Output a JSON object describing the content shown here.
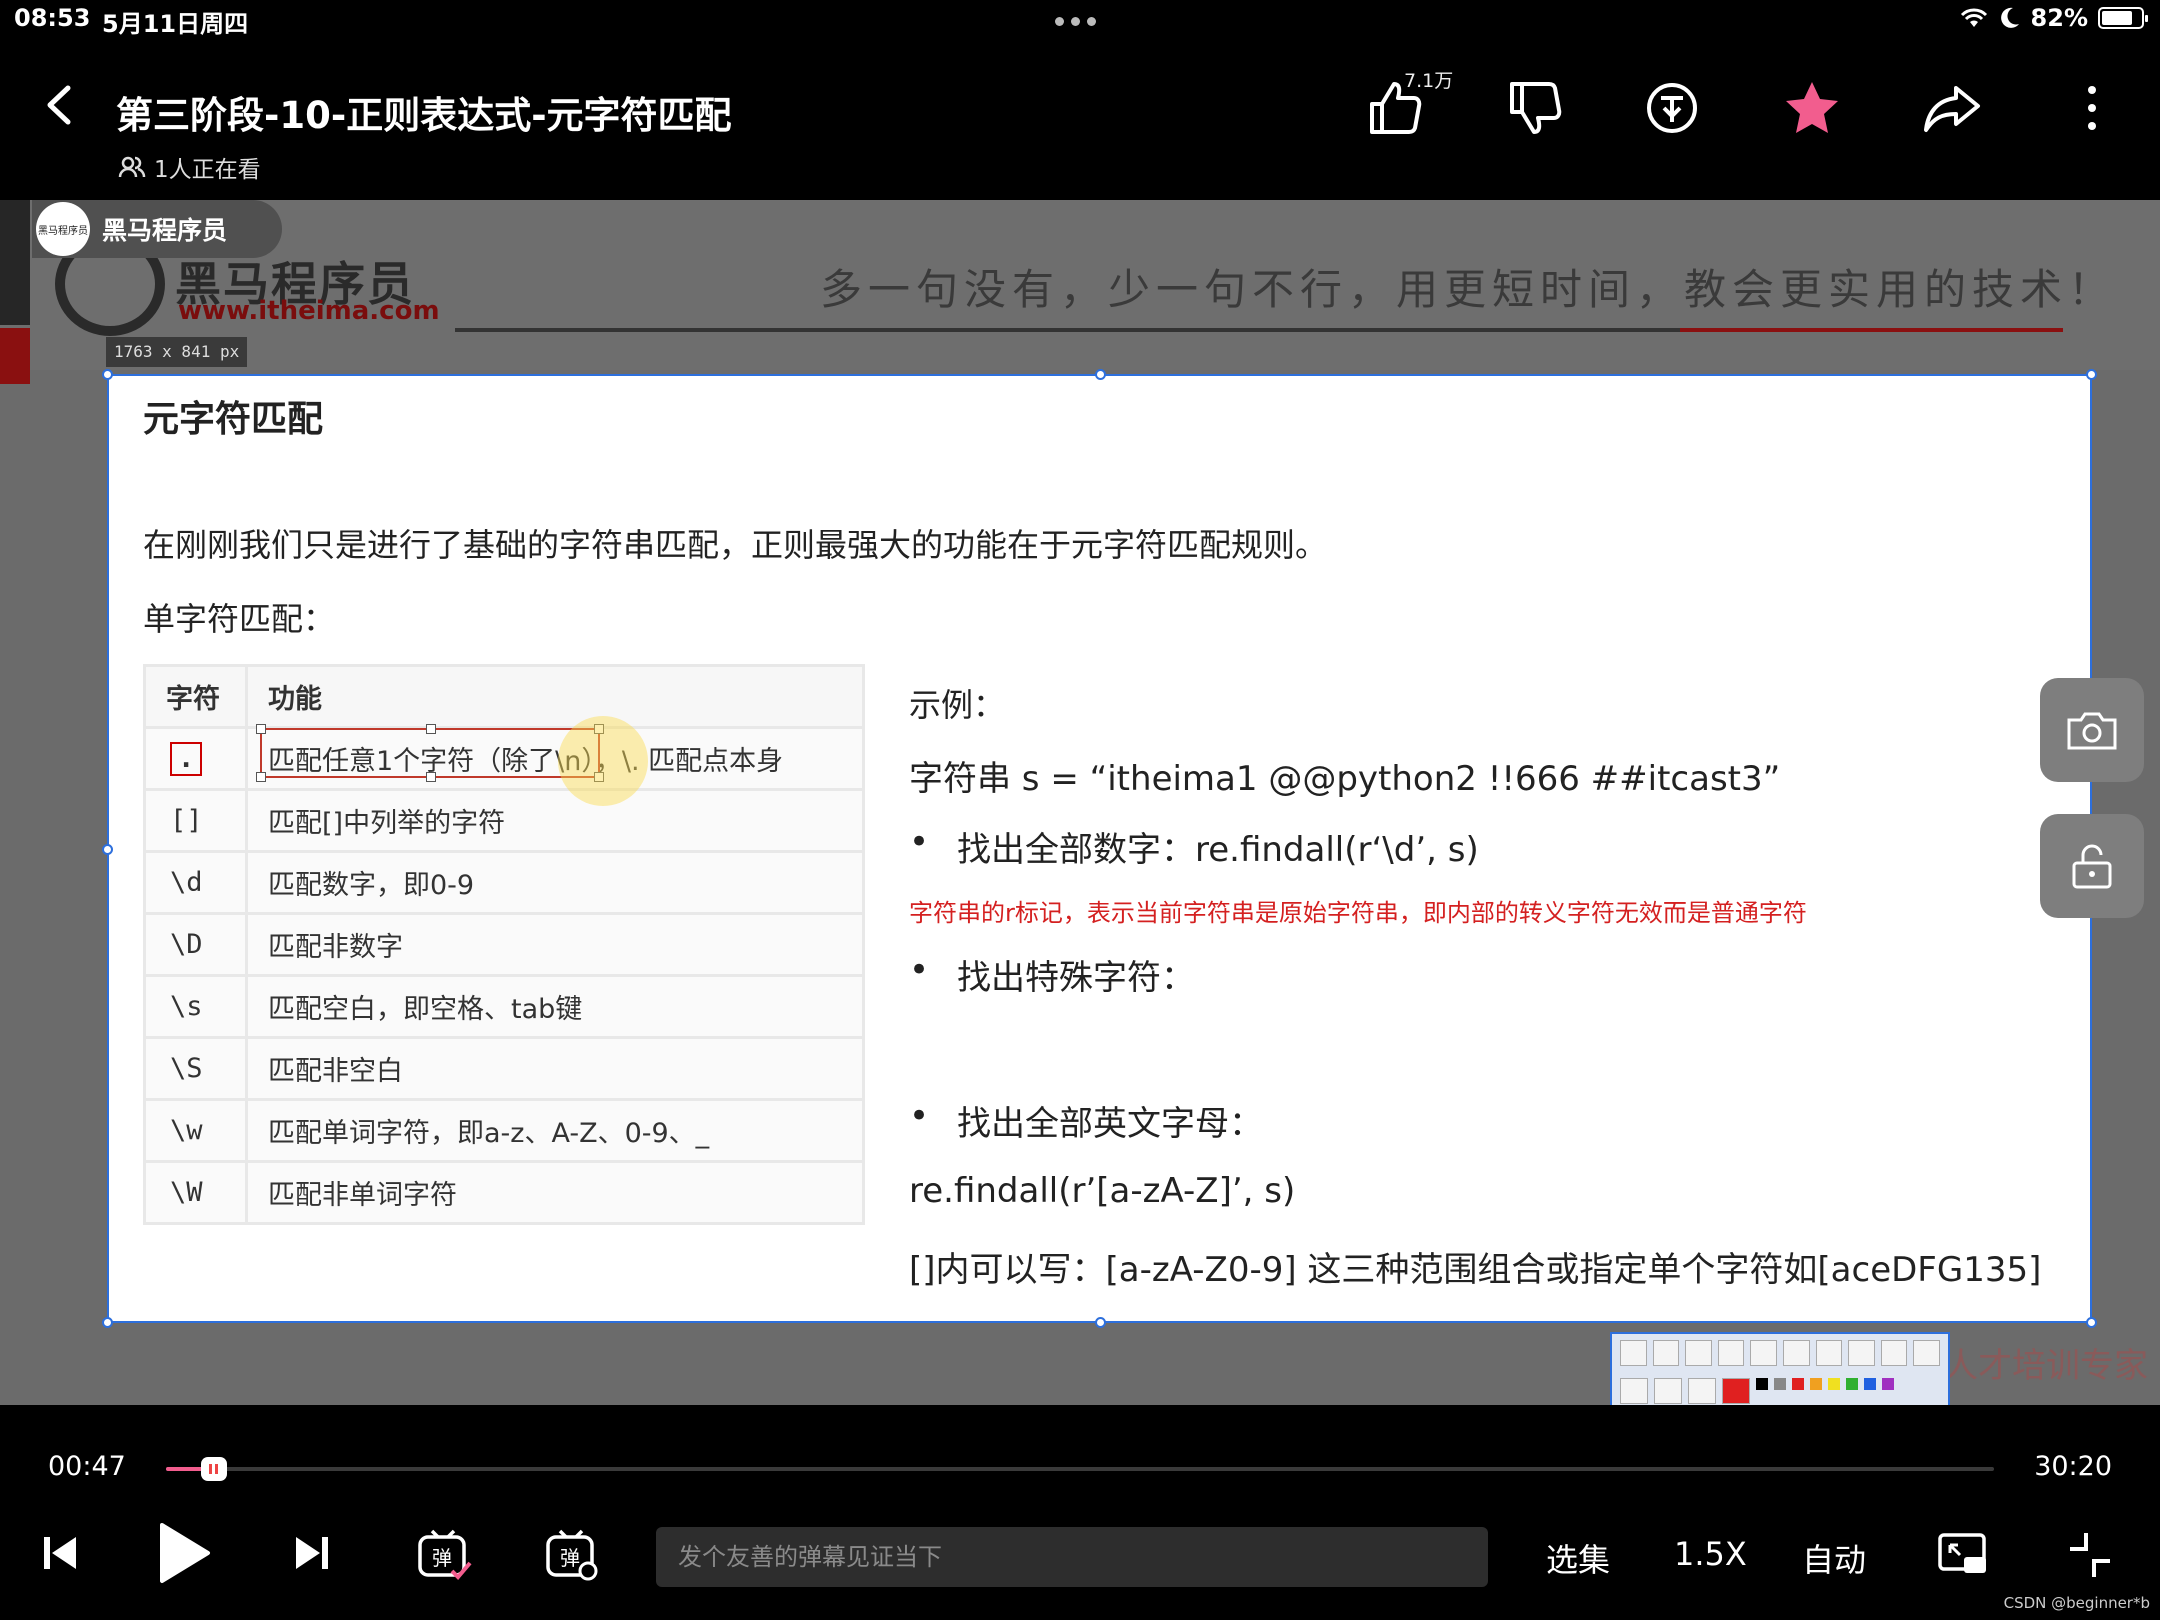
{
  "status_bar": {
    "time": "08:53",
    "date": "5月11日周四",
    "battery": "82%"
  },
  "header": {
    "title": "第三阶段-10-正则表达式-元字符匹配",
    "viewers": "1人正在看",
    "like_count": "7.1万"
  },
  "channel": {
    "name": "黑马程序员",
    "avatar_text": "黑马程序员"
  },
  "banner": {
    "brand_name": "黑马程序员",
    "brand_url": "www.itheima.com",
    "slogan": "多一句没有，少一句不行，用更短时间，教会更实用的技术！"
  },
  "dimension_label": "1763 x 841 px",
  "slide": {
    "title": "元字符匹配",
    "intro": "在刚刚我们只是进行了基础的字符串匹配，正则最强大的功能在于元字符匹配规则。",
    "subtitle": "单字符匹配：",
    "table": {
      "headers": [
        "字符",
        "功能"
      ],
      "rows": [
        {
          "symbol": ".",
          "desc": "匹配任意1个字符（除了\\n），\\. 匹配点本身"
        },
        {
          "symbol": "[]",
          "desc": "匹配[]中列举的字符"
        },
        {
          "symbol": "\\d",
          "desc": "匹配数字，即0-9"
        },
        {
          "symbol": "\\D",
          "desc": "匹配非数字"
        },
        {
          "symbol": "\\s",
          "desc": "匹配空白，即空格、tab键"
        },
        {
          "symbol": "\\S",
          "desc": "匹配非空白"
        },
        {
          "symbol": "\\w",
          "desc": "匹配单词字符，即a-z、A-Z、0-9、_"
        },
        {
          "symbol": "\\W",
          "desc": "匹配非单词字符"
        }
      ]
    },
    "example": {
      "label": "示例：",
      "string": "字符串 s = “itheima1 @@python2 !!666 ##itcast3”",
      "bullet1": "找出全部数字：re.findall(r‘\\d’, s)",
      "note": "字符串的r标记，表示当前字符串是原始字符串，即内部的转义字符无效而是普通字符",
      "bullet2": "找出特殊字符：",
      "bullet3": "找出全部英文字母：",
      "code": "re.findall(r’[a-zA-Z]’, s)",
      "tip": "[]内可以写：[a-zA-Z0-9] 这三种范围组合或指定单个字符如[aceDFG135]"
    }
  },
  "corner_watermark": "人才培训专家",
  "player": {
    "current_time": "00:47",
    "total_time": "30:20",
    "progress": 0.026,
    "danmaku_placeholder": "发个友善的弹幕见证当下",
    "episodes_label": "选集",
    "speed_label": "1.5X",
    "quality_label": "自动"
  },
  "site_watermark": "CSDN @beginner*b",
  "colors": {
    "accent": "#f25d8e",
    "selection": "#2d6fdc",
    "favorite": "#f25d8e",
    "note_red": "#d42020"
  }
}
